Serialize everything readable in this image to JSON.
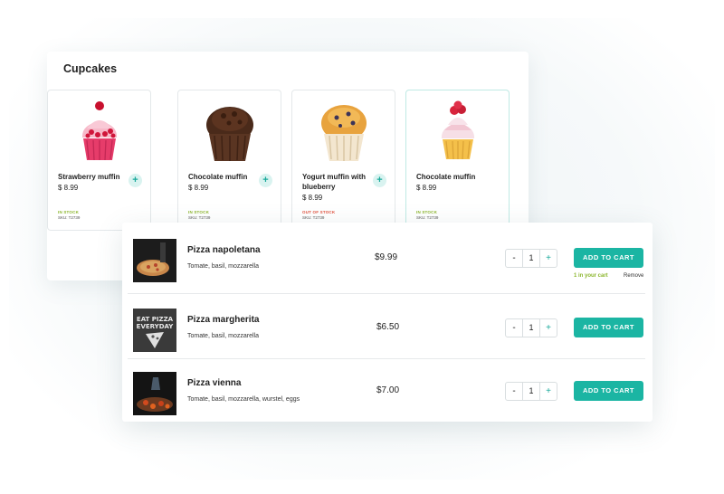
{
  "cupcakes": {
    "title": "Cupcakes",
    "products": [
      {
        "name": "Chocolate muffin",
        "price": "$ 8.99",
        "stock": "IN STOCK",
        "sku": "SKU: T2739",
        "image": "chocolate-muffin"
      },
      {
        "name": "Yogurt muffin with blueberry",
        "price": "$ 8.99",
        "stock": "OUT OF STOCK",
        "sku": "SKU: T2739",
        "image": "blueberry-muffin"
      },
      {
        "name": "Chocolate muffin",
        "price": "$ 8.99",
        "stock": "IN STOCK",
        "sku": "SKU: T2739",
        "image": "raspberry-cupcake"
      },
      {
        "name": "Strawberry muffin",
        "price": "$ 8.99",
        "stock": "IN STOCK",
        "sku": "SKU: T2739",
        "image": "strawberry-cupcake"
      }
    ],
    "add_symbol": "+"
  },
  "pizzas": {
    "items": [
      {
        "name": "Pizza napoletana",
        "description": "Tomate, basil, mozzarella",
        "price": "$9.99",
        "quantity": "1",
        "in_cart": "1 in your cart",
        "remove": "Remove"
      },
      {
        "name": "Pizza margherita",
        "description": "Tomate, basil, mozzarella",
        "price": "$6.50",
        "quantity": "1"
      },
      {
        "name": "Pizza vienna",
        "description": "Tomate, basil, mozzarella, wurstel, eggs",
        "price": "$7.00",
        "quantity": "1"
      }
    ],
    "add_to_cart_label": "ADD TO CART",
    "minus_symbol": "-",
    "plus_symbol": "+",
    "thumb2_text": [
      "EAT PIZZA",
      "EVERYDAY"
    ]
  },
  "colors": {
    "accent": "#1bb5a3",
    "in_stock": "#8ab52a",
    "out_of_stock": "#e0533f"
  }
}
